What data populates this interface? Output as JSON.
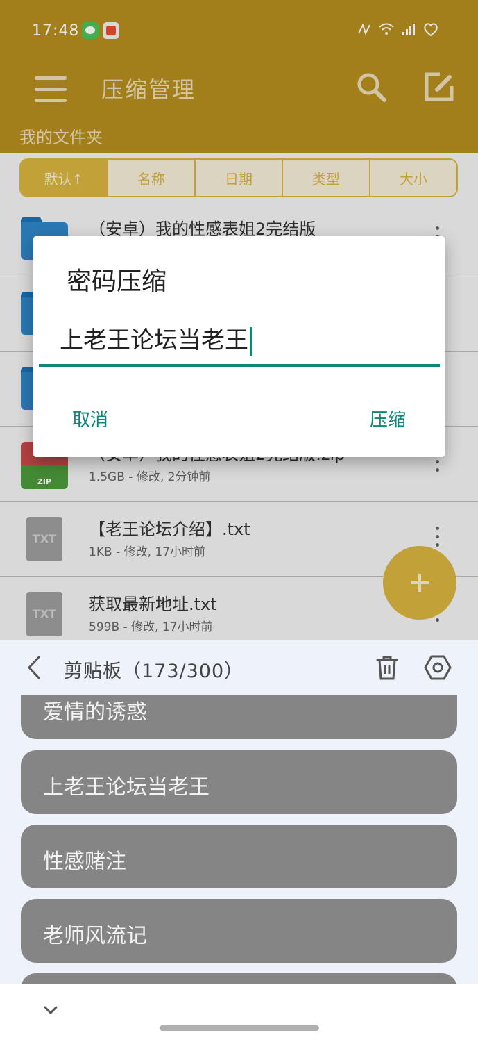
{
  "status_bar": {
    "time": "17:48"
  },
  "app_bar": {
    "title": "压缩管理",
    "folder_title": "我的文件夹"
  },
  "sort_bar": {
    "buttons": [
      "默认↑",
      "名称",
      "日期",
      "类型",
      "大小"
    ]
  },
  "files": [
    {
      "name": "（安卓）我的性感表姐2完结版",
      "meta": "",
      "type": "folder"
    },
    {
      "name": "",
      "meta": "",
      "type": "folder"
    },
    {
      "name": "",
      "meta": "",
      "type": "folder"
    },
    {
      "name": "（安卓）我的性感表姐2完结版.zip",
      "meta": "1.5GB - 修改, 2分钟前",
      "type": "zip",
      "icon_label": "ZIP"
    },
    {
      "name": "【老王论坛介绍】.txt",
      "meta": "1KB - 修改, 17小时前",
      "type": "txt",
      "icon_label": "TXT"
    },
    {
      "name": "获取最新地址.txt",
      "meta": "599B - 修改, 17小时前",
      "type": "txt",
      "icon_label": "TXT"
    }
  ],
  "dialog": {
    "title": "密码压缩",
    "input_value": "上老王论坛当老王",
    "cancel_label": "取消",
    "confirm_label": "压缩"
  },
  "clipboard": {
    "title": "剪贴板（173/300）",
    "items": [
      "爱情的诱惑",
      "上老王论坛当老王",
      "性感赌注",
      "老师风流记",
      ""
    ]
  },
  "colors": {
    "app_bar": "#b58e1f",
    "accent": "#d9b440",
    "dialog_accent": "#10857a",
    "clip_item": "#858585"
  }
}
